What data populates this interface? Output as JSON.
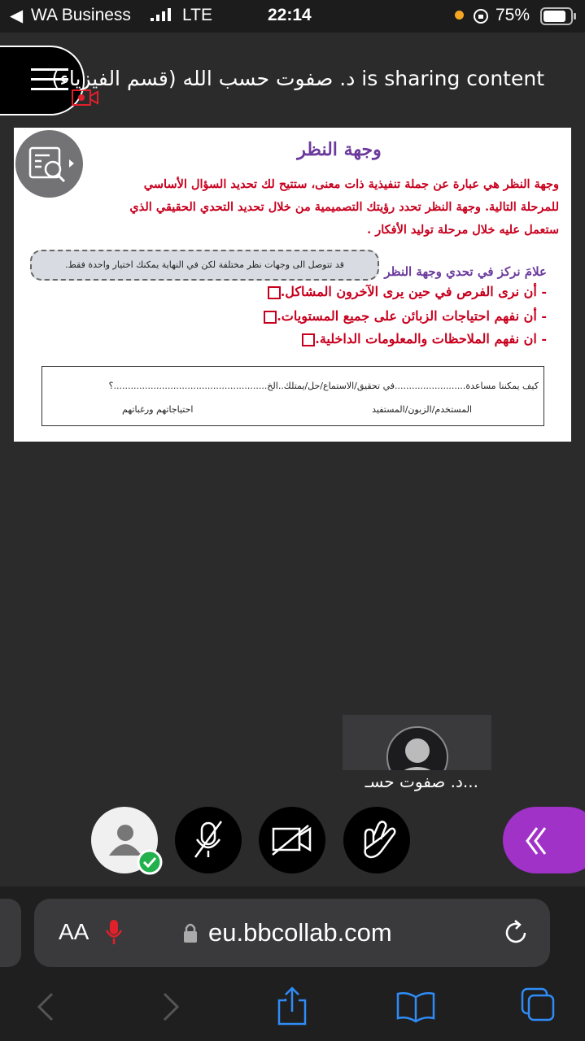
{
  "status_bar": {
    "carrier": "WA Business",
    "network": "LTE",
    "time": "22:14",
    "battery": "75%"
  },
  "header": {
    "sharing_text": "د. صفوت حسب الله (قسم الفيزياء) is sharing content"
  },
  "slide": {
    "title": "وجهة النظر",
    "paragraph_lines": [
      "وجهة النظر هي عبارة عن جملة تنفيذية ذات معنى، ستتيح لك تحديد السؤال الأساسي",
      "للمرحلة التالية. وجهة النظر تحدد رؤيتك التصميمية من خلال تحديد التحدي الحقيقي الذي",
      "ستعمل عليه خلال مرحلة توليد الأفكار ."
    ],
    "note": "قد تتوصل الى وجهات نظر مختلفة لكن في النهاية يمكنك اختيار واحدة فقط.",
    "focus_label": "علامَ نركز في تحدي وجهة النظر",
    "bullets": [
      "- أن نرى الفرص في حين يرى الآخرون المشاكل.",
      "- أن نفهم احتياجات الزبائن على جميع المستويات.",
      "- ان نفهم الملاحظات والمعلومات الداخلية."
    ],
    "task": {
      "line": "كيف يمكننا مساعدة.........................في تحقيق/الاستماع/حل/يمتلك..الخ......................................................؟",
      "label_user": "المستخدم/الزبون/المستفيد",
      "label_needs": "احتياجاتهم ورغباتهم"
    }
  },
  "participant": {
    "name": "د. صفوت حسـ..."
  },
  "browser": {
    "aa_label": "AA",
    "url": "eu.bbcollab.com"
  },
  "colors": {
    "accent_purple": "#a032c8",
    "slide_title": "#6b3a9c",
    "slide_red": "#c8001e",
    "status_green": "#22b14c",
    "record_red": "#e0202a",
    "ios_blue": "#2f8cf6"
  }
}
